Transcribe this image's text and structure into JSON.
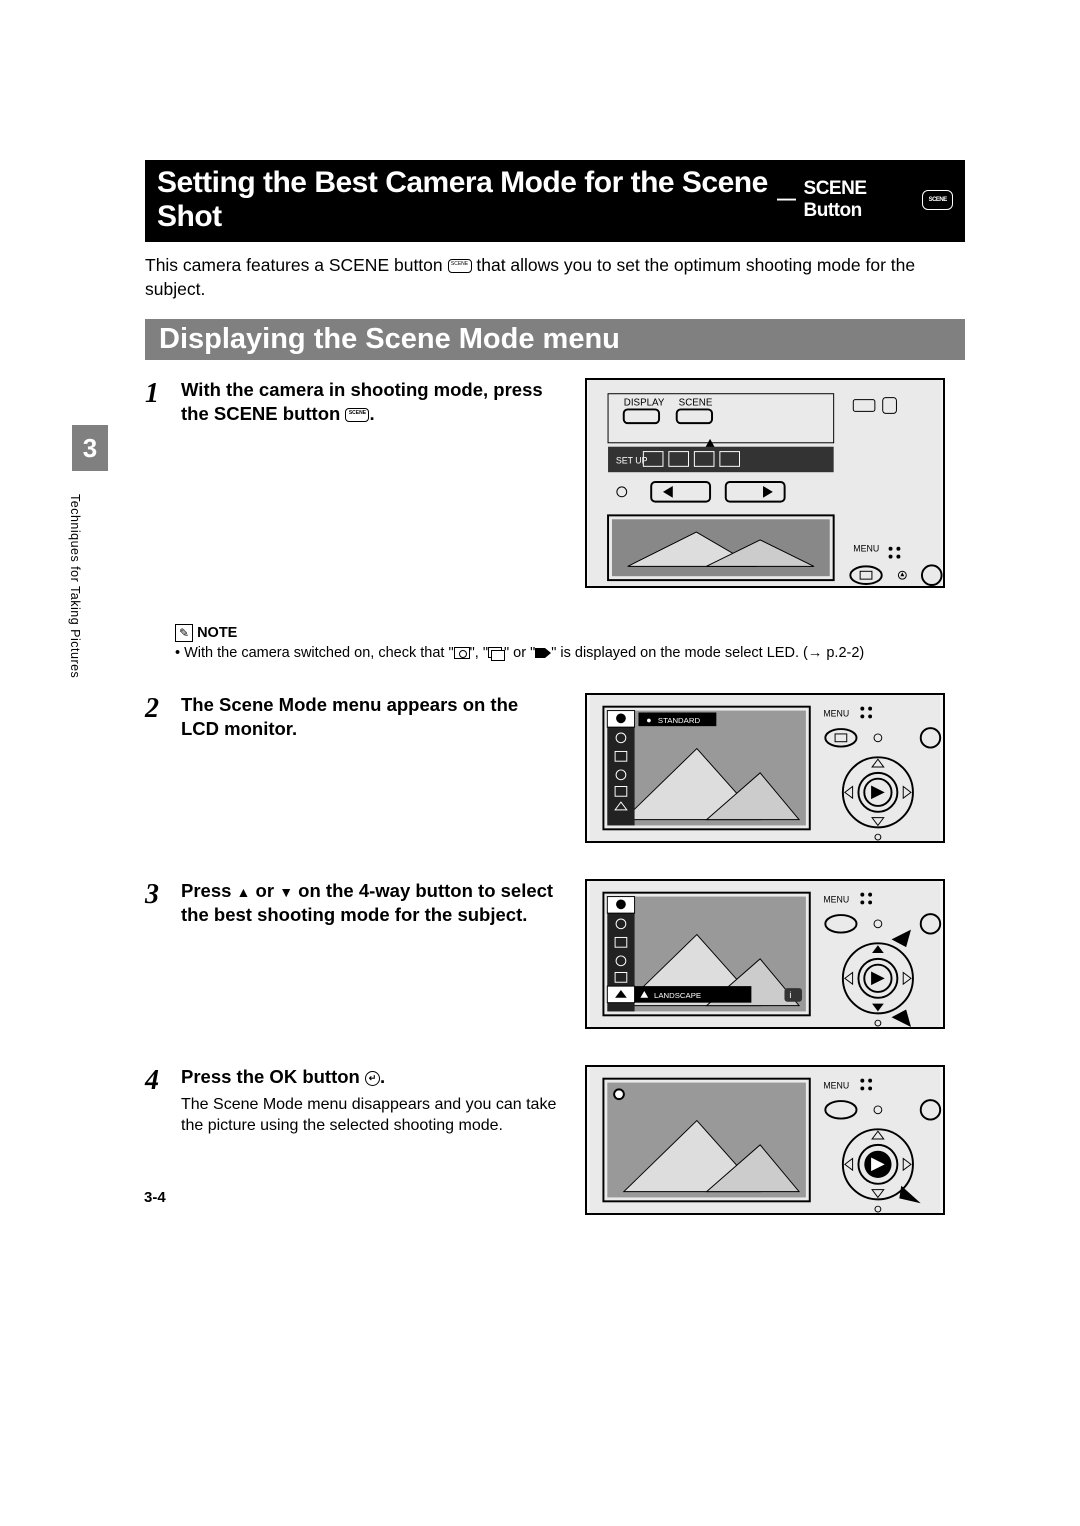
{
  "title_main": "Setting the Best Camera Mode for the Scene Shot",
  "title_sep": "—",
  "title_sub": "SCENE Button",
  "scene_icon_label": "SCENE",
  "intro_a": "This camera features a SCENE button ",
  "intro_b": " that allows you to set the optimum shooting mode for the subject.",
  "section_header": "Displaying the Scene Mode menu",
  "chapter_num": "3",
  "side_text": "Techniques for Taking Pictures",
  "steps": {
    "s1": {
      "num": "1",
      "title_a": "With the camera in shooting mode, press the SCENE button ",
      "title_b": "."
    },
    "s2": {
      "num": "2",
      "title": "The Scene Mode menu appears on the LCD monitor."
    },
    "s3": {
      "num": "3",
      "title_a": "Press ",
      "title_b": " or ",
      "title_c": " on the 4-way button to select the best shooting mode for the subject."
    },
    "s4": {
      "num": "4",
      "title_a": "Press the OK button ",
      "title_b": ".",
      "text": "The Scene Mode menu disappears and you can take the picture using the selected shooting mode."
    }
  },
  "note": {
    "label": "NOTE",
    "text_a": "• With the camera switched on, check that \"",
    "text_b": "\", \"",
    "text_c": "\" or \"",
    "text_d": "\" is displayed on the mode select LED. (",
    "arrow": "→",
    "ref": " p.2-2)"
  },
  "illust_labels": {
    "display": "DISPLAY",
    "scene": "SCENE",
    "menu": "MENU",
    "standard": "STANDARD",
    "landscape": "LANDSCAPE"
  },
  "page_number": "3-4"
}
